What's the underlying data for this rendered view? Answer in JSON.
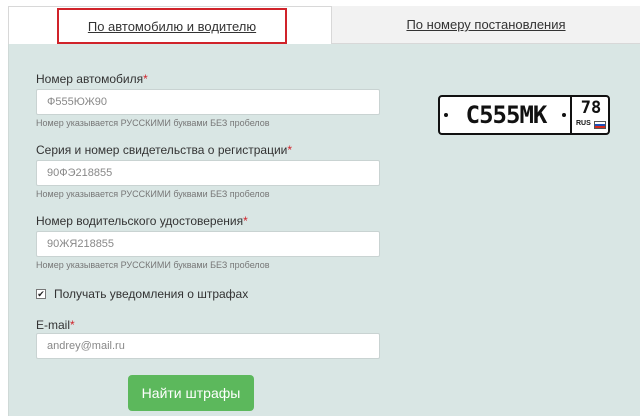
{
  "tabs": {
    "active_label": "По автомобилю и водителю",
    "inactive_label": "По номеру постановления"
  },
  "form": {
    "car_number": {
      "label": "Номер автомобиля",
      "required_mark": "*",
      "placeholder": "Ф555ЮЖ90",
      "hint": "Номер указывается РУССКИМИ буквами БЕЗ пробелов"
    },
    "registration": {
      "label": "Серия и номер свидетельства о регистрации",
      "required_mark": "*",
      "placeholder": "90ФЭ218855",
      "hint": "Номер указывается РУССКИМИ буквами БЕЗ пробелов"
    },
    "license": {
      "label": "Номер водительского удостоверения",
      "required_mark": "*",
      "placeholder": "90ЖЯ218855",
      "hint": "Номер указывается РУССКИМИ буквами БЕЗ пробелов"
    },
    "notify": {
      "label": "Получать уведомления о штрафах",
      "checked": true,
      "check_glyph": "✔"
    },
    "email": {
      "label": "E-mail",
      "required_mark": "*",
      "placeholder": "andrey@mail.ru"
    },
    "submit_label": "Найти штрафы"
  },
  "plate": {
    "main": "С555МК",
    "region": "78",
    "country": "RUS",
    "flag_colors": [
      "#ffffff",
      "#1c4fb8",
      "#d52b1e"
    ]
  },
  "colors": {
    "panel_bg": "#d9e6e4",
    "highlight_border": "#d0232a",
    "button_green": "#5cb85c"
  }
}
